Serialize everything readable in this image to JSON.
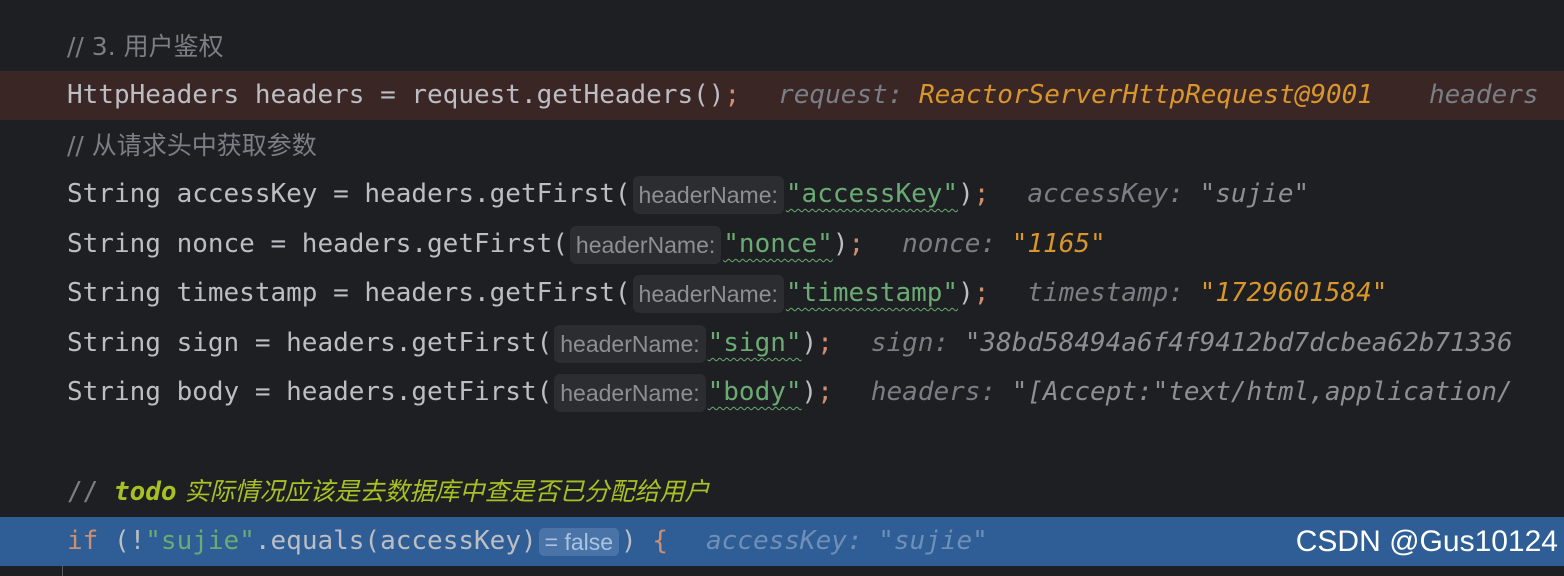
{
  "lines": {
    "comment1": "// 3. 用户鉴权",
    "headers_line": {
      "code": "HttpHeaders headers = request.getHeaders()",
      "semi": ";",
      "debug_name": "request: ",
      "debug_value": "ReactorServerHttpRequest@9001",
      "debug_name2": "headers"
    },
    "comment2": "// 从请求头中获取参数",
    "accessKey_line": {
      "prefix": "String accessKey = headers.getFirst(",
      "hint": "headerName:",
      "arg": "\"accessKey\"",
      "suffix": ")",
      "semi": ";",
      "debug_name": "accessKey: ",
      "debug_value": "\"sujie\""
    },
    "nonce_line": {
      "prefix": "String nonce = headers.getFirst(",
      "hint": "headerName:",
      "arg": "\"nonce\"",
      "suffix": ")",
      "semi": ";",
      "debug_name": "nonce: ",
      "debug_value": "\"1165\""
    },
    "timestamp_line": {
      "prefix": "String timestamp = headers.getFirst(",
      "hint": "headerName:",
      "arg": "\"timestamp\"",
      "suffix": ")",
      "semi": ";",
      "debug_name": "timestamp: ",
      "debug_value": "\"1729601584\""
    },
    "sign_line": {
      "prefix": "String sign = headers.getFirst(",
      "hint": "headerName:",
      "arg": "\"sign\"",
      "suffix": ")",
      "semi": ";",
      "debug_name": "sign: ",
      "debug_value": "\"38bd58494a6f4f9412bd7dcbea62b71336"
    },
    "body_line": {
      "prefix": "String body = headers.getFirst(",
      "hint": "headerName:",
      "arg": "\"body\"",
      "suffix": ")",
      "semi": ";",
      "debug_name": "headers: ",
      "debug_value": "\"[Accept:\"text/html,application/"
    },
    "todo_comment": {
      "slashes": "// ",
      "todo": "todo",
      "text": " 实际情况应该是去数据库中查是否已分配给用户"
    },
    "if_line": {
      "kw": "if",
      "open": " (!",
      "str": "\"sujie\"",
      "call": ".equals(accessKey)",
      "hint": "= false",
      "close": ") ",
      "brace": "{",
      "debug_name": "accessKey: ",
      "debug_value": "\"sujie\""
    }
  },
  "watermark": "CSDN @Gus10124",
  "colors": {
    "background": "#1e1f22",
    "breakpoint_line": "#3b2626",
    "execution_line": "#2e5e95",
    "string": "#6aab73",
    "keyword": "#cf8e6d",
    "debug_value": "#d9962a"
  }
}
